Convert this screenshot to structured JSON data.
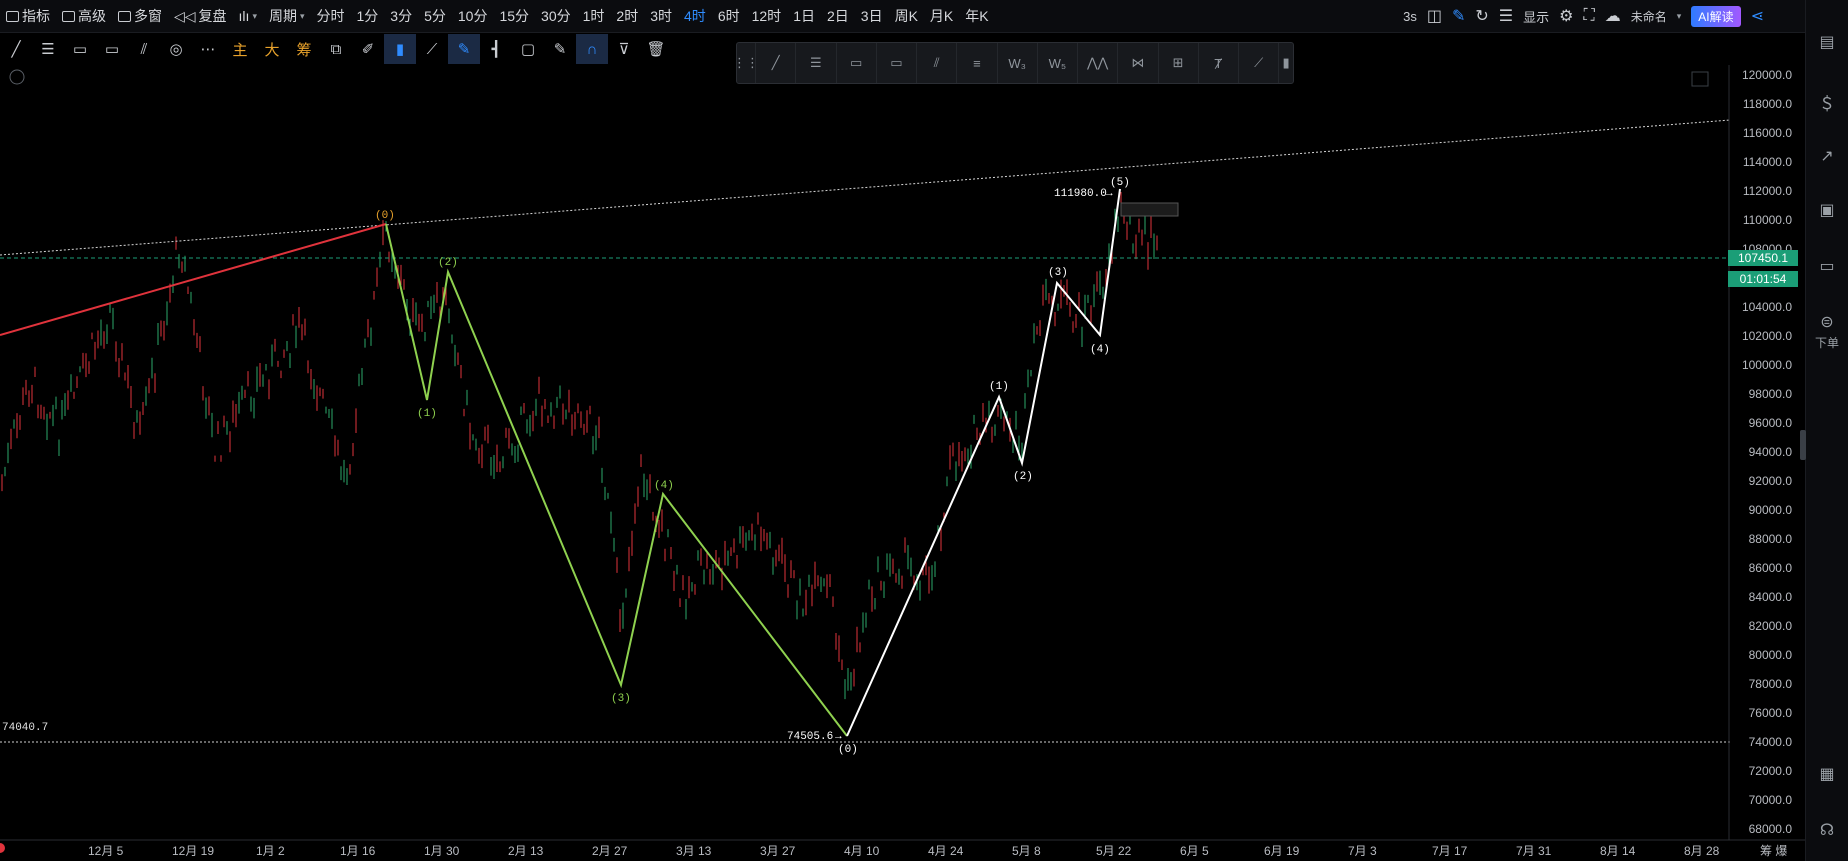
{
  "toolbar": {
    "indicator": "指标",
    "advanced": "高级",
    "multiwindow": "多窗",
    "replay": "复盘",
    "period": "周期",
    "intervals": [
      "分时",
      "1分",
      "3分",
      "5分",
      "10分",
      "15分",
      "30分",
      "1时",
      "2时",
      "3时",
      "4时",
      "6时",
      "12时",
      "1日",
      "2日",
      "3日",
      "周K",
      "月K",
      "年K"
    ],
    "active_interval": "4时",
    "refresh": "3s",
    "display": "显示",
    "layout_name": "未命名",
    "ai_button": "AI解读"
  },
  "drawing_tools": {
    "main_label": "主",
    "big_label": "大",
    "chip_label": "筹"
  },
  "chart": {
    "price_axis": [
      "120000.0",
      "118000.0",
      "116000.0",
      "114000.0",
      "112000.0",
      "110000.0",
      "108000.0",
      "104000.0",
      "102000.0",
      "100000.0",
      "98000.0",
      "96000.0",
      "94000.0",
      "92000.0",
      "90000.0",
      "88000.0",
      "86000.0",
      "84000.0",
      "82000.0",
      "80000.0",
      "78000.0",
      "76000.0",
      "74000.0",
      "72000.0",
      "70000.0",
      "68000.0"
    ],
    "current_price": "107450.1",
    "countdown": "01:01:54",
    "time_axis": [
      "12月 5",
      "12月 19",
      "1月 2",
      "1月 16",
      "1月 30",
      "2月 13",
      "2月 27",
      "3月 13",
      "3月 27",
      "4月 10",
      "4月 24",
      "5月 8",
      "5月 22",
      "6月 5",
      "6月 19",
      "7月 3",
      "7月 17",
      "7月 31",
      "8月 14",
      "8月 28"
    ],
    "horizontal_line_label": "74040.7",
    "high_label": "111980.0",
    "low_label": "74505.6",
    "wave_orange": [
      "(0)"
    ],
    "wave_green": [
      "(1)",
      "(2)",
      "(3)",
      "(4)"
    ],
    "wave_white": [
      "(0)",
      "(1)",
      "(2)",
      "(3)",
      "(4)",
      "(5)"
    ],
    "corner_tab": "筹 爆",
    "colors": {
      "green_wave": "#8fd14f",
      "white_wave": "#ffffff",
      "red_trend": "#e0333c",
      "orange_label": "#e8a22b",
      "current_price_bg": "#1b9e77"
    }
  },
  "rightbar": {
    "order_label": "下单"
  }
}
